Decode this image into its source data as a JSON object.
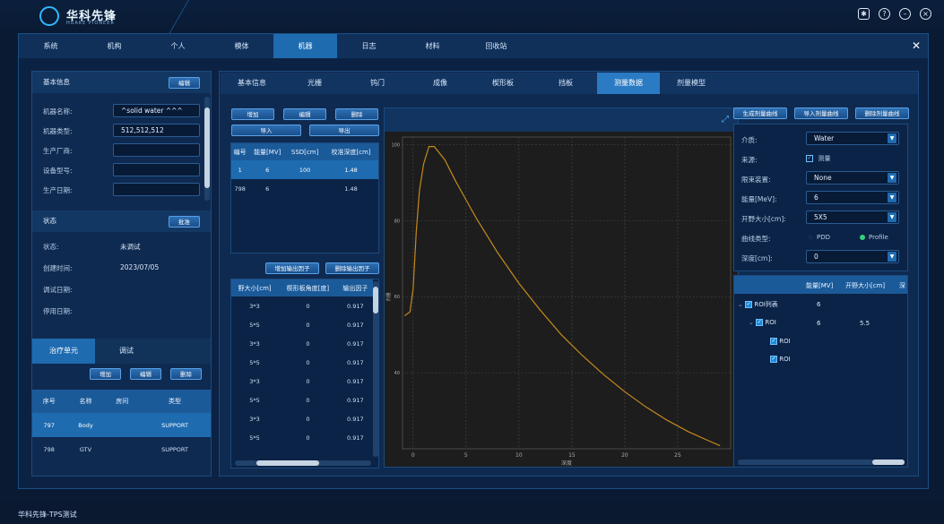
{
  "app": {
    "logo_cn": "华科先锋",
    "logo_en": "HUAKE PIONEER",
    "footer_title": "华科先锋-TPS测试"
  },
  "nav": [
    "系统",
    "机构",
    "个人",
    "模体",
    "机器",
    "日志",
    "材料",
    "回收站"
  ],
  "nav_active": 4,
  "left": {
    "basic_title": "基本信息",
    "edit_btn": "编辑",
    "fields": [
      {
        "label": "机器名称:",
        "value": "^solid water ^^^"
      },
      {
        "label": "机器类型:",
        "value": "512,512,512"
      },
      {
        "label": "生产厂商:",
        "value": ""
      },
      {
        "label": "设备型号:",
        "value": ""
      },
      {
        "label": "生产日期:",
        "value": ""
      }
    ],
    "status_title": "状态",
    "approve_btn": "批准",
    "status_rows": [
      {
        "label": "状态:",
        "value": "未调试"
      },
      {
        "label": "创建时间:",
        "value": "2023/07/05"
      },
      {
        "label": "调试日期:",
        "value": ""
      },
      {
        "label": "停用日期:",
        "value": ""
      }
    ],
    "unit_tabs": [
      "治疗单元",
      "调试"
    ],
    "unit_btns": [
      "增加",
      "编辑",
      "删除"
    ],
    "unit_cols": [
      "序号",
      "名称",
      "房间",
      "类型"
    ],
    "unit_rows": [
      [
        "797",
        "Body",
        "",
        "SUPPORT"
      ],
      [
        "798",
        "GTV",
        "",
        "SUPPORT"
      ]
    ]
  },
  "tabs2": [
    "基本信息",
    "光栅",
    "钨门",
    "成像",
    "楔形板",
    "挡板",
    "测量数据",
    "剂量模型"
  ],
  "tabs2_active": 6,
  "meas": {
    "btns_row1": [
      "增加",
      "编辑",
      "删除"
    ],
    "btns_row2": [
      "导入",
      "导出"
    ],
    "cols": [
      "编号",
      "能量[MV]",
      "SSD[cm]",
      "校准深度[cm]"
    ],
    "rows": [
      [
        "1",
        "6",
        "100",
        "1.48"
      ],
      [
        "798",
        "6",
        "",
        "1.48"
      ]
    ],
    "factor_btns": [
      "增加输出因子",
      "删除输出因子"
    ],
    "factor_cols": [
      "野大小[cm]",
      "楔形板角度[度]",
      "输出因子"
    ],
    "factor_rows": [
      [
        "3*3",
        "0",
        "0.917"
      ],
      [
        "5*5",
        "0",
        "0.917"
      ],
      [
        "3*3",
        "0",
        "0.917"
      ],
      [
        "5*5",
        "0",
        "0.917"
      ],
      [
        "3*3",
        "0",
        "0.917"
      ],
      [
        "5*5",
        "0",
        "0.917"
      ],
      [
        "3*3",
        "0",
        "0.917"
      ],
      [
        "5*5",
        "0",
        "0.917"
      ]
    ]
  },
  "right": {
    "btns": [
      "生成剂量曲线",
      "导入剂量曲线",
      "删除剂量曲线"
    ],
    "medium_label": "介质:",
    "medium_value": "Water",
    "source_label": "来源:",
    "source_value": "测量",
    "beam_label": "限束装置:",
    "beam_value": "None",
    "energy_label": "能量[MeV]:",
    "energy_value": "6",
    "field_label": "开野大小[cm]:",
    "field_value": "5X5",
    "curve_label": "曲线类型:",
    "curve_opt1": "PDD",
    "curve_opt2": "Profile",
    "depth_label": "深度[cm]:",
    "depth_value": "0",
    "tree_cols": [
      "能量[MV]",
      "开野大小[cm]",
      "深"
    ],
    "tree": [
      {
        "label": "ROI列表",
        "energy": "6",
        "field": ""
      },
      {
        "label": "ROI",
        "energy": "6",
        "field": "5.5"
      },
      {
        "label": "ROI",
        "energy": "",
        "field": ""
      },
      {
        "label": "ROI",
        "energy": "",
        "field": ""
      }
    ]
  },
  "chart_data": {
    "type": "line",
    "xlabel": "深度",
    "ylabel": "剂量",
    "xlim": [
      -1,
      30
    ],
    "ylim": [
      20,
      102
    ],
    "xticks": [
      0,
      5,
      10,
      15,
      20,
      25
    ],
    "yticks": [
      40,
      60,
      80,
      100
    ],
    "grid": true,
    "series": [
      {
        "color": "#c58a1c",
        "x": [
          -0.8,
          -0.3,
          0,
          0.3,
          0.6,
          1.0,
          1.5,
          2.0,
          3,
          4,
          5,
          6,
          7,
          8,
          9,
          10,
          12,
          14,
          16,
          18,
          20,
          22,
          24,
          26,
          28,
          29
        ],
        "y": [
          55,
          56,
          62,
          77,
          88,
          95,
          99.5,
          99.5,
          96,
          90.5,
          85.5,
          80.5,
          76,
          71.5,
          67.5,
          63.5,
          56.5,
          50,
          44.5,
          39.5,
          35,
          31,
          27.5,
          24.5,
          22,
          20.8
        ]
      }
    ]
  }
}
